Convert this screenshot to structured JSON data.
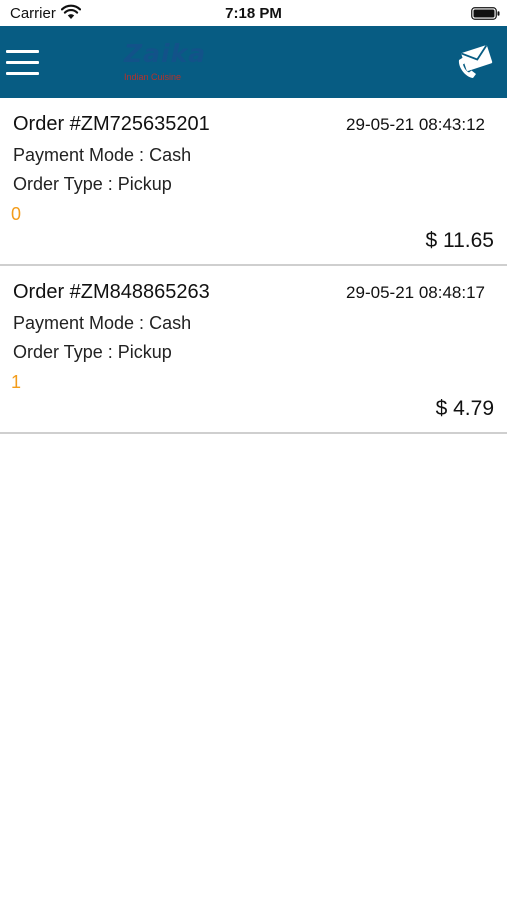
{
  "status_bar": {
    "carrier": "Carrier",
    "time": "7:18 PM"
  },
  "header": {
    "background_color": "#075c83",
    "menu_icon": "hamburger-menu-icon",
    "logo_word": "Zaika",
    "logo_tagline": "Indian Cuisine",
    "contact_icon": "phone-envelope-icon"
  },
  "orders": [
    {
      "id": "Order #ZM725635201",
      "date": "29-05-21 08:43:12",
      "payment": "Payment Mode : Cash",
      "type": "Order Type :  Pickup",
      "status": "0",
      "total": "$ 11.65"
    },
    {
      "id": "Order #ZM848865263",
      "date": "29-05-21 08:48:17",
      "payment": "Payment Mode : Cash",
      "type": "Order Type :  Pickup",
      "status": "1",
      "total": "$ 4.79"
    }
  ],
  "colors": {
    "status_accent": "#f39c1a",
    "divider": "#cfcfcf"
  }
}
